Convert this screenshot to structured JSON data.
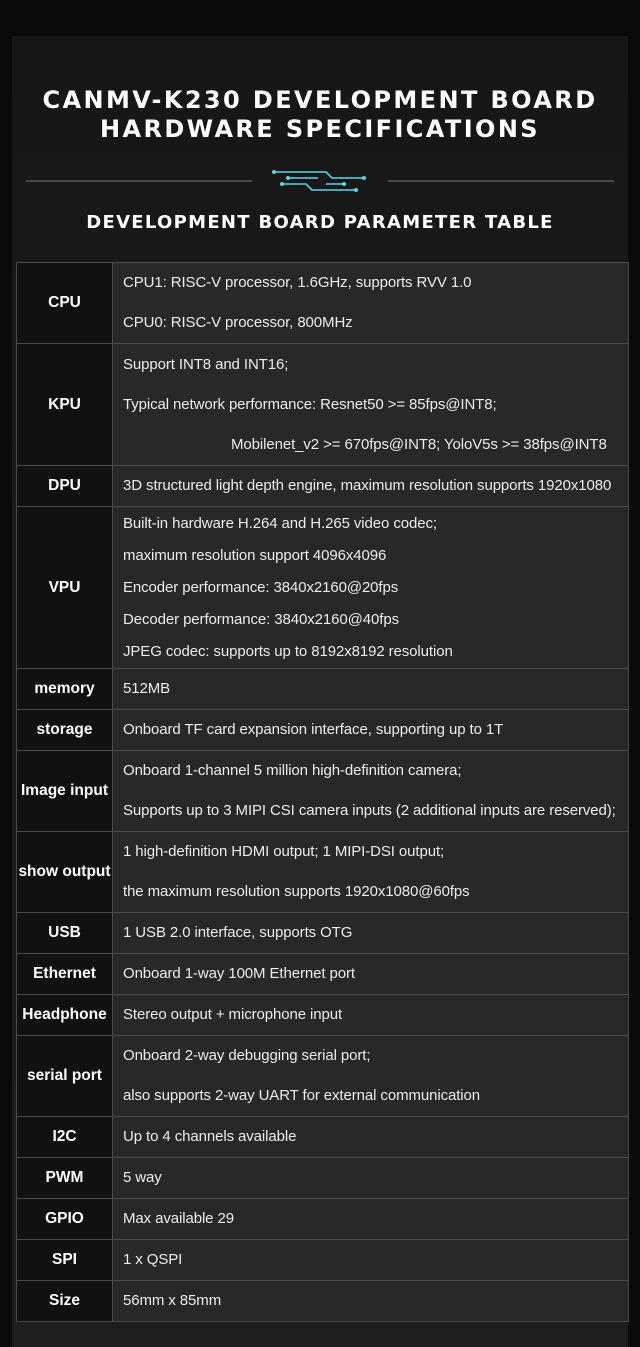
{
  "title_lines": [
    "CANMV-K230 DEVELOPMENT BOARD",
    "HARDWARE SPECIFICATIONS"
  ],
  "subtitle": "DEVELOPMENT BOARD PARAMETER TABLE",
  "colors": {
    "accent": "#5fd3e6",
    "table_border": "#4b4b4b",
    "label_cell": "#111111",
    "value_cell": "#282828"
  },
  "specs": [
    {
      "label": "CPU",
      "lines": [
        "CPU1: RISC-V processor, 1.6GHz, supports RVV 1.0",
        "CPU0: RISC-V processor, 800MHz"
      ]
    },
    {
      "label": "KPU",
      "lines": [
        "Support INT8 and INT16;",
        "Typical network performance: Resnet50 >= 85fps@INT8;",
        "Mobilenet_v2 >= 670fps@INT8; YoloV5s >= 38fps@INT8"
      ]
    },
    {
      "label": "DPU",
      "lines": [
        "3D structured light depth engine, maximum resolution supports 1920x1080"
      ]
    },
    {
      "label": "VPU",
      "lines": [
        "Built-in hardware H.264 and H.265 video codec;",
        "maximum resolution support 4096x4096",
        "Encoder performance: 3840x2160@20fps",
        "Decoder performance: 3840x2160@40fps",
        "JPEG codec: supports up to 8192x8192 resolution"
      ]
    },
    {
      "label": "memory",
      "lines": [
        "512MB"
      ]
    },
    {
      "label": "storage",
      "lines": [
        "Onboard TF card expansion interface, supporting up to 1T"
      ]
    },
    {
      "label": "Image input",
      "lines": [
        "Onboard 1-channel 5 million high-definition camera;",
        "Supports up to 3 MIPI CSI camera inputs (2 additional inputs are reserved);"
      ]
    },
    {
      "label": "show output",
      "lines": [
        "1 high-definition HDMI output; 1 MIPI-DSI output;",
        "the maximum resolution supports 1920x1080@60fps"
      ]
    },
    {
      "label": "USB",
      "lines": [
        "1 USB 2.0 interface, supports OTG"
      ]
    },
    {
      "label": "Ethernet",
      "lines": [
        "Onboard 1-way 100M Ethernet port"
      ]
    },
    {
      "label": "Headphone",
      "lines": [
        "Stereo output + microphone input"
      ]
    },
    {
      "label": "serial port",
      "lines": [
        "Onboard 2-way debugging serial port;",
        "also supports 2-way UART for external communication"
      ]
    },
    {
      "label": "I2C",
      "lines": [
        "Up to 4 channels available"
      ]
    },
    {
      "label": "PWM",
      "lines": [
        "5 way"
      ]
    },
    {
      "label": "GPIO",
      "lines": [
        "Max available 29"
      ]
    },
    {
      "label": "SPI",
      "lines": [
        "1 x QSPI"
      ]
    },
    {
      "label": "Size",
      "lines": [
        "56mm x 85mm"
      ]
    }
  ]
}
